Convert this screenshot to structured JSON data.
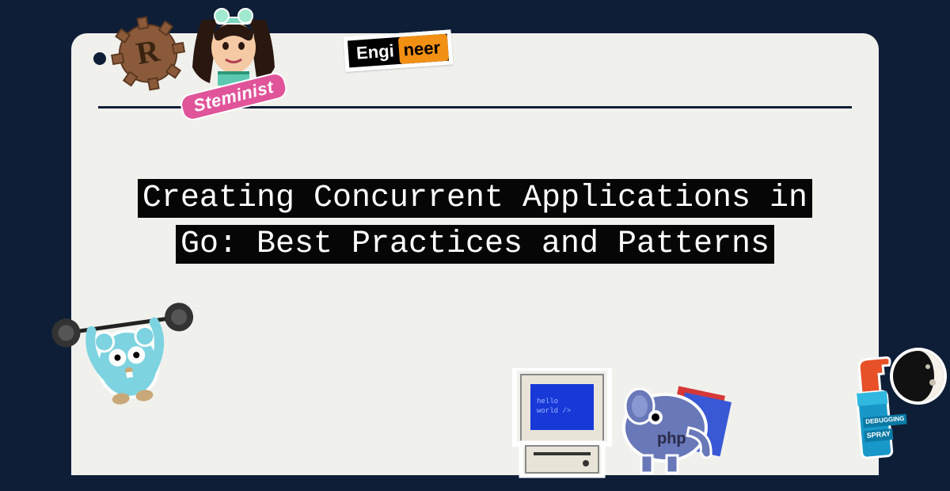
{
  "title": "Creating Concurrent Applications in Go: Best Practices and Patterns",
  "stickers": {
    "rust": "rust-gear",
    "steminist_label": "Steminist",
    "engineer_left": "Engi",
    "engineer_right": "neer",
    "gopher": "go-gopher-lifting",
    "computer_screen": "hello world /",
    "php": "php",
    "spray_label_1": "DEBUGGING",
    "spray_label_2": "SPRAY",
    "moon": "moon-phase"
  }
}
